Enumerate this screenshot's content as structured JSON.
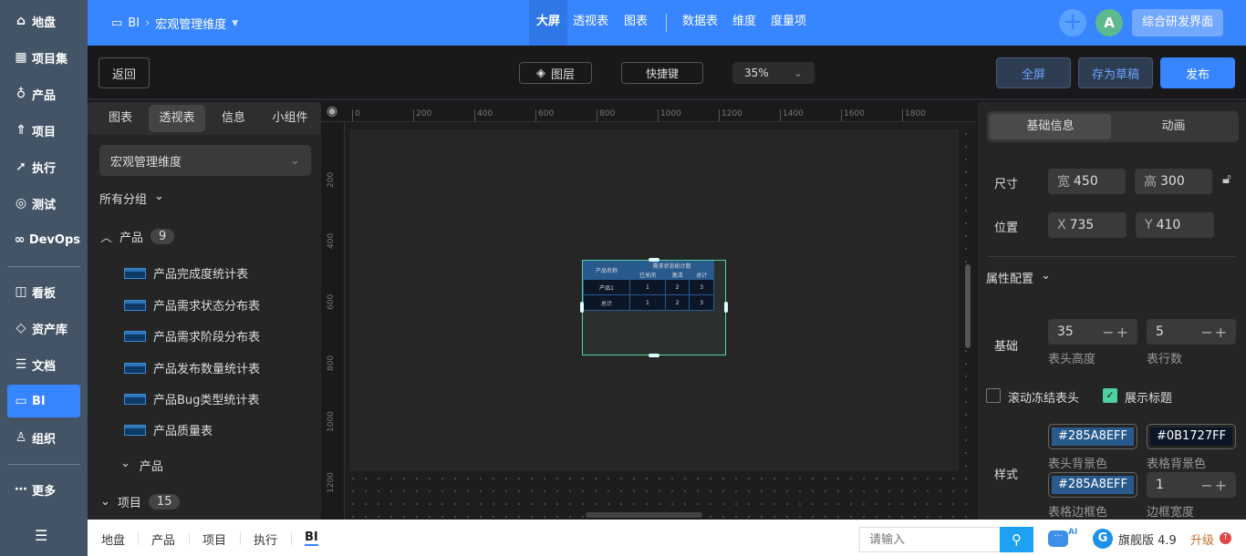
{
  "sidebar": {
    "items": [
      {
        "label": "地盘",
        "icon": "home-icon"
      },
      {
        "label": "项目集",
        "icon": "grid-icon"
      },
      {
        "label": "产品",
        "icon": "bulb-icon"
      },
      {
        "label": "项目",
        "icon": "rocket-icon"
      },
      {
        "label": "执行",
        "icon": "run-icon"
      },
      {
        "label": "测试",
        "icon": "test-icon"
      },
      {
        "label": "DevOps",
        "icon": "infinity-icon"
      },
      {
        "label": "看板",
        "icon": "board-icon"
      },
      {
        "label": "资产库",
        "icon": "diamond-icon"
      },
      {
        "label": "文档",
        "icon": "doc-icon"
      },
      {
        "label": "BI",
        "icon": "bi-icon"
      },
      {
        "label": "组织",
        "icon": "user-icon"
      },
      {
        "label": "更多",
        "icon": "more-icon"
      }
    ],
    "active": "BI"
  },
  "header": {
    "module": "BI",
    "dimension": "宏观管理维度",
    "tabs": [
      "大屏",
      "透视表",
      "图表"
    ],
    "tabs2": [
      "数据表",
      "维度",
      "度量项"
    ],
    "avatar": "A",
    "workspace": "综合研发界面"
  },
  "toolbar": {
    "back": "返回",
    "layers": "图层",
    "shortcuts": "快捷键",
    "zoom": "35%",
    "fullscreen": "全屏",
    "save_draft": "存为草稿",
    "publish": "发布"
  },
  "left": {
    "tabs": [
      "图表",
      "透视表",
      "信息",
      "小组件"
    ],
    "active_tab": "透视表",
    "dimension_select": "宏观管理维度",
    "group_filter": "所有分组",
    "groups": [
      {
        "name": "产品",
        "count": "9",
        "items": [
          "产品完成度统计表",
          "产品需求状态分布表",
          "产品需求阶段分布表",
          "产品发布数量统计表",
          "产品Bug类型统计表",
          "产品质量表"
        ],
        "subgroup": "产品"
      },
      {
        "name": "项目",
        "count": "15"
      }
    ]
  },
  "ruler": {
    "x": [
      "0",
      "200",
      "400",
      "600",
      "800",
      "1000",
      "1200",
      "1400",
      "1600",
      "1800"
    ],
    "y": [
      "200",
      "400",
      "600",
      "800",
      "1000",
      "1200"
    ]
  },
  "widget": {
    "col_name": "产品名称",
    "group_header": "需求状态统计数",
    "cols": [
      "已关闭",
      "激活",
      "总计"
    ],
    "rows": [
      [
        "产品1",
        "1",
        "2",
        "3"
      ],
      [
        "总计",
        "1",
        "2",
        "3"
      ]
    ]
  },
  "right": {
    "tabs": [
      "基础信息",
      "动画"
    ],
    "size_label": "尺寸",
    "width_prefix": "宽",
    "width": "450",
    "height_prefix": "高",
    "height": "300",
    "pos_label": "位置",
    "x_prefix": "X",
    "x": "735",
    "y_prefix": "Y",
    "y": "410",
    "attr_title": "属性配置",
    "basic_label": "基础",
    "header_height": "35",
    "header_height_label": "表头高度",
    "rows": "5",
    "rows_label": "表行数",
    "freeze_label": "滚动冻结表头",
    "freeze": false,
    "show_title_label": "展示标题",
    "show_title": true,
    "style_label": "样式",
    "header_bg": "#285A8EFF",
    "header_bg_label": "表头背景色",
    "table_bg": "#0B1727FF",
    "table_bg_label": "表格背景色",
    "border_color": "#285A8EFF",
    "border_color_label": "表格边框色",
    "border_width": "1",
    "border_width_label": "边框宽度"
  },
  "bottom": {
    "nav": [
      "地盘",
      "产品",
      "项目",
      "执行",
      "BI"
    ],
    "active": "BI",
    "search_placeholder": "请输入",
    "ai": "AI",
    "edition": "旗舰版 4.9",
    "upgrade": "升级"
  }
}
